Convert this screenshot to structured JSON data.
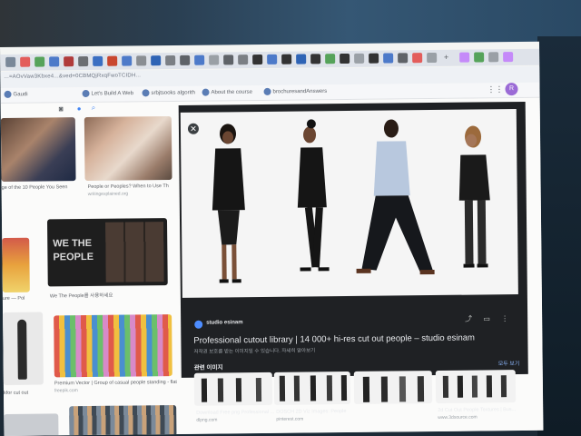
{
  "browser": {
    "url": "...=AOvVaw3Kbxe4...&ved=0CBMQjRxqFwoTCIDH...",
    "bookmarks": [
      "Gaudi",
      "Let's Build A Web",
      "srbjtsooks algorith",
      "About the course",
      "brochuresandAnswers"
    ],
    "profile_initial": "R"
  },
  "results": {
    "left_captions": [
      {
        "title": "ge of the 10 People You Seen",
        "source": ""
      },
      {
        "title": "People or Peoples? When to Use Th",
        "source": "writingexplained.org"
      },
      {
        "title": "We The People를 사용하세요",
        "source": ""
      },
      {
        "title": "Premium Vector | Group of casual people standing - flat",
        "source": "freepik.com"
      },
      {
        "title": "kfor cut out",
        "source": ""
      }
    ],
    "we_the_people_text": "WE THE PEOPLE"
  },
  "panel": {
    "site_name": "studio esinam",
    "title": "Professional cutout library | 14 000+ hi-res cut out people – studio esinam",
    "subtitle": "저작권 보호를 받는 이미지일 수 있습니다. 자세히 알아보기",
    "related_label": "관련 이미지",
    "more_label": "모두 보기",
    "related": [
      {
        "caption": "Download Free png Professional ...",
        "source": "dlpng.com"
      },
      {
        "caption": "DOSCH 2D Viz Images: People",
        "source": "pinterest.com"
      },
      {
        "caption": "",
        "source": ""
      },
      {
        "caption": "2d Cut Out People Textures | Bus...",
        "source": "www.3dsource.com"
      }
    ]
  },
  "colors": {
    "panel_bg": "#1f2124",
    "accent": "#8ab4f8",
    "page_bg": "#fbfbfa"
  }
}
